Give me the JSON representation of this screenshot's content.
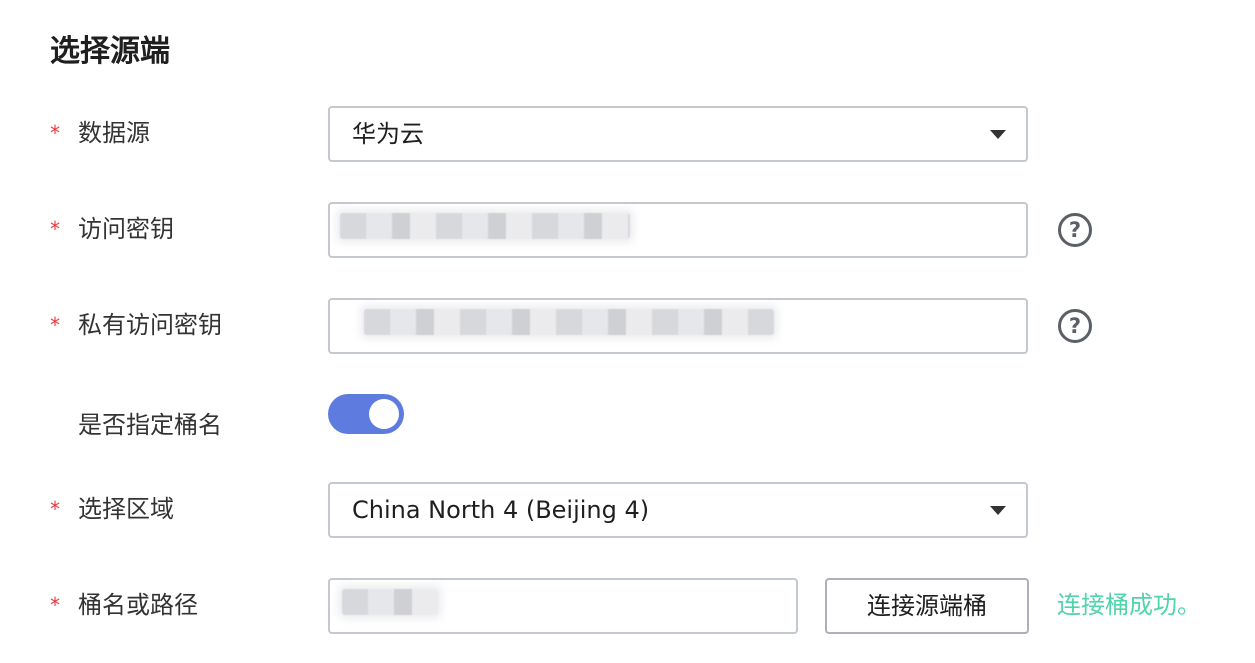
{
  "section_title": "选择源端",
  "required_mark": "*",
  "fields": {
    "data_source": {
      "label": "数据源",
      "value": "华为云"
    },
    "access_key": {
      "label": "访问密钥",
      "help": "?"
    },
    "secret_key": {
      "label": "私有访问密钥",
      "help": "?"
    },
    "specify_bucket": {
      "label": "是否指定桶名",
      "enabled": true
    },
    "region": {
      "label": "选择区域",
      "value": "China North 4 (Beijing 4)"
    },
    "bucket_path": {
      "label": "桶名或路径",
      "connect_button": "连接源端桶",
      "status": "连接桶成功。"
    }
  },
  "colors": {
    "accent": "#5e7ce0",
    "required": "#e8393d",
    "success": "#50d4ab"
  },
  "icons": [
    "chevron-down-icon",
    "help-icon"
  ]
}
